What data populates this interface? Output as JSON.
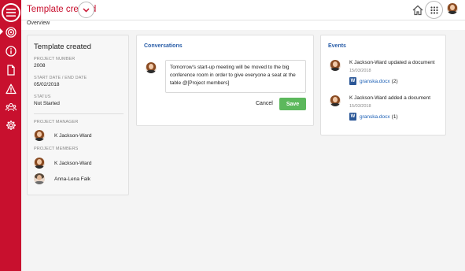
{
  "header": {
    "title": "Template created",
    "icons": {
      "home": "home-icon",
      "apps": "grid-icon",
      "chevron": "chevron-down-icon"
    }
  },
  "subnav": {
    "overview": "Overview"
  },
  "sidebar": {
    "items": [
      {
        "icon": "target-icon"
      },
      {
        "icon": "info-icon"
      },
      {
        "icon": "document-icon"
      },
      {
        "icon": "warning-icon"
      },
      {
        "icon": "people-icon"
      },
      {
        "icon": "gear-icon"
      }
    ],
    "accent": "#c8102e"
  },
  "project": {
    "title": "Template created",
    "number_label": "PROJECT NUMBER",
    "number": "2008",
    "dates_label": "START DATE / END DATE",
    "dates": "05/02/2018",
    "status_label": "STATUS",
    "status": "Not Started",
    "manager_label": "PROJECT MANAGER",
    "manager": "K Jackson-Ward",
    "members_label": "PROJECT MEMBERS",
    "members": [
      "K Jackson-Ward",
      "Anna-Lena Falk"
    ]
  },
  "conversations": {
    "heading": "Conversations",
    "message": "Tomorrow's start-up meeting will be moved to the big conference room in order to give everyone a seat at the table @[Project members]",
    "cancel": "Cancel",
    "save": "Save",
    "save_color": "#5cb85c"
  },
  "events": {
    "heading": "Events",
    "items": [
      {
        "text": "K Jackson-Ward updated a document",
        "date": "15/03/2018",
        "file": "granska.docx",
        "count": "(2)"
      },
      {
        "text": "K Jackson-Ward added a document",
        "date": "15/03/2018",
        "file": "granska.docx",
        "count": "(1)"
      }
    ]
  }
}
